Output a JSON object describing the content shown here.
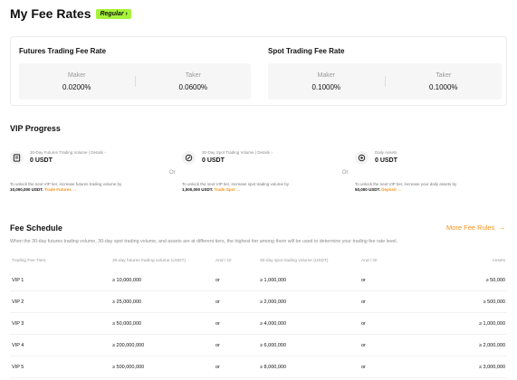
{
  "header": {
    "title": "My Fee Rates",
    "badge": "Regular",
    "badge_chevron_icon": "chevron-right-icon"
  },
  "fee_rates": {
    "futures": {
      "title": "Futures Trading Fee Rate",
      "maker_label": "Maker",
      "maker_value": "0.0200%",
      "taker_label": "Taker",
      "taker_value": "0.0600%"
    },
    "spot": {
      "title": "Spot Trading Fee Rate",
      "maker_label": "Maker",
      "maker_value": "0.1000%",
      "taker_label": "Taker",
      "taker_value": "0.1000%"
    }
  },
  "vip_progress": {
    "title": "VIP Progress",
    "or_label": "Or",
    "futures": {
      "icon": "futures-volume-icon",
      "label": "30-Day Futures Trading Volume",
      "details": "Details",
      "value": "0 USDT",
      "desc": "To unlock the next VIP tier, increase futures trading volume by",
      "amount": "10,000,000 USDT.",
      "link": "Trade Futures"
    },
    "spot": {
      "icon": "spot-volume-icon",
      "label": "30-Day Spot Trading Volume",
      "details": "Details",
      "value": "0 USDT",
      "desc": "To unlock the next VIP tier, increase spot trading volume by",
      "amount": "1,000,000 USDT.",
      "link": "Trade Spot"
    },
    "assets": {
      "icon": "daily-assets-icon",
      "label": "Daily Assets",
      "value": "0 USDT",
      "desc": "To unlock the next VIP tier, increase your daily assets by",
      "amount": "50,000 USDT.",
      "link": "Deposit"
    }
  },
  "schedule": {
    "title": "Fee Schedule",
    "more_label": "More Fee Rules",
    "description": "When the 30-day futures trading volume, 30-day spot trading volume, and assets are at different tiers, the highest tier among them will be used to determine your trading fee rate level.",
    "columns": [
      "Trading Fee Tiers",
      "30-day futures trading volume (USDT)",
      "And / Or",
      "30-day spot trading volume (USDT)",
      "And / Or",
      "Assets"
    ],
    "rows": [
      {
        "tier": "VIP 1",
        "futures": "≥ 10,000,000",
        "op1": "or",
        "spot": "≥ 1,000,000",
        "op2": "or",
        "assets": "≥ 50,000"
      },
      {
        "tier": "VIP 2",
        "futures": "≥ 25,000,000",
        "op1": "or",
        "spot": "≥ 2,000,000",
        "op2": "or",
        "assets": "≥ 500,000"
      },
      {
        "tier": "VIP 3",
        "futures": "≥ 50,000,000",
        "op1": "or",
        "spot": "≥ 4,000,000",
        "op2": "or",
        "assets": "≥ 1,000,000"
      },
      {
        "tier": "VIP 4",
        "futures": "≥ 200,000,000",
        "op1": "or",
        "spot": "≥ 6,000,000",
        "op2": "or",
        "assets": "≥ 2,000,000"
      },
      {
        "tier": "VIP 5",
        "futures": "≥ 500,000,000",
        "op1": "or",
        "spot": "≥ 8,000,000",
        "op2": "or",
        "assets": "≥ 3,000,000"
      }
    ]
  },
  "colors": {
    "accent": "#f7931a",
    "badge": "#a6f23a"
  }
}
